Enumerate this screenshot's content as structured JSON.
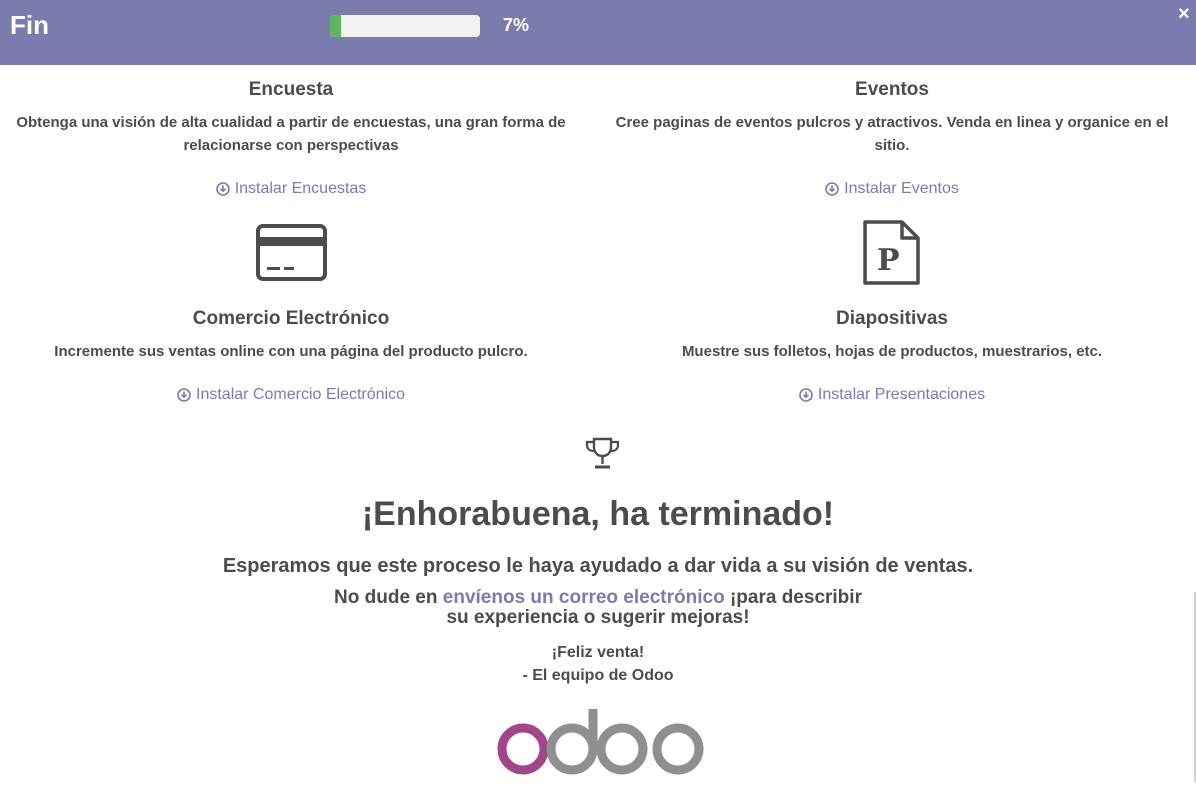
{
  "header": {
    "title": "Fin",
    "progress_percent": 7,
    "progress_label": "7%",
    "close_icon": "×",
    "accent_color": "#7c7bad",
    "progress_color": "#5cb85c"
  },
  "apps": {
    "survey": {
      "title": "Encuesta",
      "description": "Obtenga una visión de alta cualidad a partir de encuestas, una gran forma de relacionarse con perspectivas",
      "install_label": "Instalar Encuestas"
    },
    "events": {
      "title": "Eventos",
      "description": "Cree paginas de eventos pulcros y atractivos. Venda en linea y organice en el sitio.",
      "install_label": "Instalar Eventos"
    },
    "ecommerce": {
      "title": "Comercio Electrónico",
      "description": "Incremente sus ventas online con una página del producto pulcro.",
      "install_label": "Instalar Comercio Electrónico",
      "icon": "credit-card-icon"
    },
    "slides": {
      "title": "Diapositivas",
      "description": "Muestre sus folletos, hojas de productos, muestrarios, etc.",
      "install_label": "Instalar Presentaciones",
      "icon": "document-p-icon"
    }
  },
  "finish": {
    "trophy_icon": "trophy-icon",
    "title": "¡Enhorabuena, ha terminado!",
    "subtitle": "Esperamos que este proceso le haya ayudado a dar vida a su visión de ventas.",
    "mail_prefix": "No dude en ",
    "mail_link": "envíenos un correo electrónico",
    "mail_suffix_line1": " ¡para describir",
    "mail_line2": "su experiencia o sugerir mejoras!",
    "sign_line1": "¡Feliz venta!",
    "sign_line2": "- El equipo de Odoo",
    "logo_text": "odoo"
  }
}
